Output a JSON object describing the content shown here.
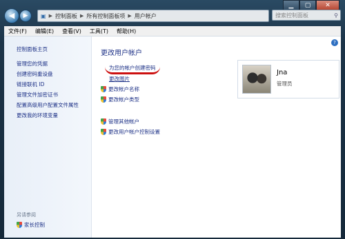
{
  "window": {
    "minimize": "▁",
    "maximize": "▢",
    "close": "✕"
  },
  "nav": {
    "back": "◀",
    "forward": "▶",
    "breadcrumb": [
      "控制面板",
      "所有控制面板项",
      "用户帐户"
    ],
    "search_placeholder": "搜索控制面板"
  },
  "menu": [
    "文件(F)",
    "编辑(E)",
    "查看(V)",
    "工具(T)",
    "帮助(H)"
  ],
  "sidebar": {
    "home": "控制面板主页",
    "items": [
      "管理您的凭据",
      "创建密码重设盘",
      "链接联机 ID",
      "管理文件加密证书",
      "配置高级用户配置文件属性",
      "更改我的环境变量"
    ],
    "see_also": "另请参阅",
    "family_safety": "家长控制"
  },
  "main": {
    "title": "更改用户帐户",
    "links": {
      "create_password": "为您的帐户创建密码",
      "change_picture": "更改图片",
      "change_name": "更改帐户名称",
      "change_type": "更改帐户类型",
      "manage_other": "管理其他帐户",
      "uac_settings": "更改用户帐户控制设置"
    }
  },
  "user": {
    "name": "Jna",
    "role": "管理员"
  }
}
